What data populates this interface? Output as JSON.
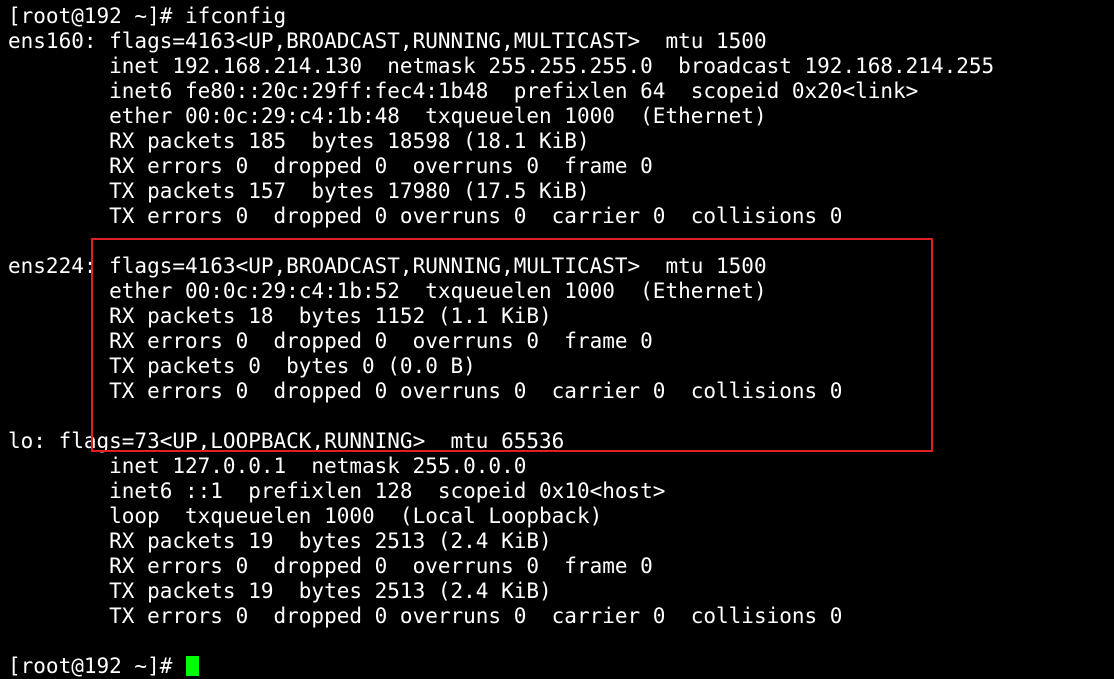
{
  "colors": {
    "background": "#000000",
    "text": "#ffffff",
    "cursor": "#00ff00",
    "highlight": "#e02020"
  },
  "terminal": {
    "lines": [
      "[root@192 ~]# ifconfig",
      "ens160: flags=4163<UP,BROADCAST,RUNNING,MULTICAST>  mtu 1500",
      "        inet 192.168.214.130  netmask 255.255.255.0  broadcast 192.168.214.255",
      "        inet6 fe80::20c:29ff:fec4:1b48  prefixlen 64  scopeid 0x20<link>",
      "        ether 00:0c:29:c4:1b:48  txqueuelen 1000  (Ethernet)",
      "        RX packets 185  bytes 18598 (18.1 KiB)",
      "        RX errors 0  dropped 0  overruns 0  frame 0",
      "        TX packets 157  bytes 17980 (17.5 KiB)",
      "        TX errors 0  dropped 0 overruns 0  carrier 0  collisions 0",
      "",
      "ens224: flags=4163<UP,BROADCAST,RUNNING,MULTICAST>  mtu 1500",
      "        ether 00:0c:29:c4:1b:52  txqueuelen 1000  (Ethernet)",
      "        RX packets 18  bytes 1152 (1.1 KiB)",
      "        RX errors 0  dropped 0  overruns 0  frame 0",
      "        TX packets 0  bytes 0 (0.0 B)",
      "        TX errors 0  dropped 0 overruns 0  carrier 0  collisions 0",
      "",
      "lo: flags=73<UP,LOOPBACK,RUNNING>  mtu 65536",
      "        inet 127.0.0.1  netmask 255.0.0.0",
      "        inet6 ::1  prefixlen 128  scopeid 0x10<host>",
      "        loop  txqueuelen 1000  (Local Loopback)",
      "        RX packets 19  bytes 2513 (2.4 KiB)",
      "        RX errors 0  dropped 0  overruns 0  frame 0",
      "        TX packets 19  bytes 2513 (2.4 KiB)",
      "        TX errors 0  dropped 0 overruns 0  carrier 0  collisions 0",
      "",
      "[root@192 ~]# "
    ]
  }
}
